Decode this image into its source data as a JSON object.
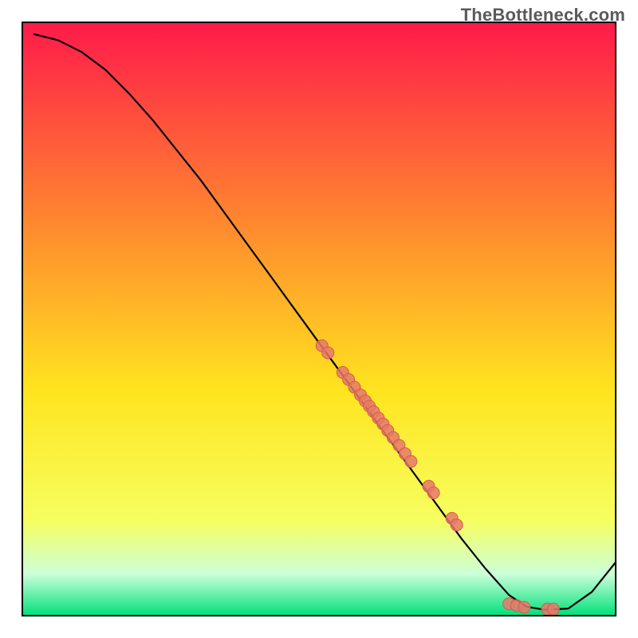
{
  "watermark": "TheBottleneck.com",
  "colors": {
    "gradient_top": "#ff1a4a",
    "gradient_mid_upper": "#ff8c2e",
    "gradient_mid": "#ffe41f",
    "gradient_lower": "#f6ff60",
    "gradient_green_pale": "#ccffd9",
    "gradient_green": "#00e07a",
    "line": "#000000",
    "point_fill": "#e5796b",
    "point_stroke": "#d95a48",
    "frame": "#000000"
  },
  "chart_data": {
    "type": "line",
    "title": "",
    "xlabel": "",
    "ylabel": "",
    "xlim": [
      0,
      100
    ],
    "ylim": [
      0,
      100
    ],
    "series": [
      {
        "name": "curve",
        "x": [
          2,
          6,
          10,
          14,
          18,
          22,
          26,
          30,
          34,
          38,
          42,
          46,
          50,
          54,
          58,
          62,
          66,
          70,
          74,
          78,
          82,
          85,
          88,
          92,
          96,
          100
        ],
        "y": [
          98,
          97,
          95,
          92,
          88,
          83.5,
          78.5,
          73.5,
          68,
          62.5,
          57,
          51.5,
          46,
          40.5,
          35,
          29.5,
          24,
          18.5,
          13,
          8,
          3.5,
          1.5,
          1,
          1.2,
          4,
          9
        ]
      }
    ],
    "scatter": [
      {
        "x": 50.5,
        "y": 45.5
      },
      {
        "x": 51.5,
        "y": 44.3
      },
      {
        "x": 54.0,
        "y": 41.0
      },
      {
        "x": 55.0,
        "y": 39.8
      },
      {
        "x": 56.0,
        "y": 38.5
      },
      {
        "x": 57.0,
        "y": 37.2
      },
      {
        "x": 57.8,
        "y": 36.2
      },
      {
        "x": 58.5,
        "y": 35.3
      },
      {
        "x": 59.2,
        "y": 34.4
      },
      {
        "x": 60.0,
        "y": 33.3
      },
      {
        "x": 60.8,
        "y": 32.3
      },
      {
        "x": 61.6,
        "y": 31.2
      },
      {
        "x": 62.5,
        "y": 30.0
      },
      {
        "x": 63.5,
        "y": 28.7
      },
      {
        "x": 64.5,
        "y": 27.3
      },
      {
        "x": 65.5,
        "y": 26.0
      },
      {
        "x": 68.5,
        "y": 21.8
      },
      {
        "x": 69.3,
        "y": 20.7
      },
      {
        "x": 72.4,
        "y": 16.4
      },
      {
        "x": 73.2,
        "y": 15.3
      },
      {
        "x": 82.0,
        "y": 2.0
      },
      {
        "x": 83.3,
        "y": 1.7
      },
      {
        "x": 84.6,
        "y": 1.4
      },
      {
        "x": 88.5,
        "y": 1.1
      },
      {
        "x": 89.5,
        "y": 1.1
      }
    ]
  }
}
